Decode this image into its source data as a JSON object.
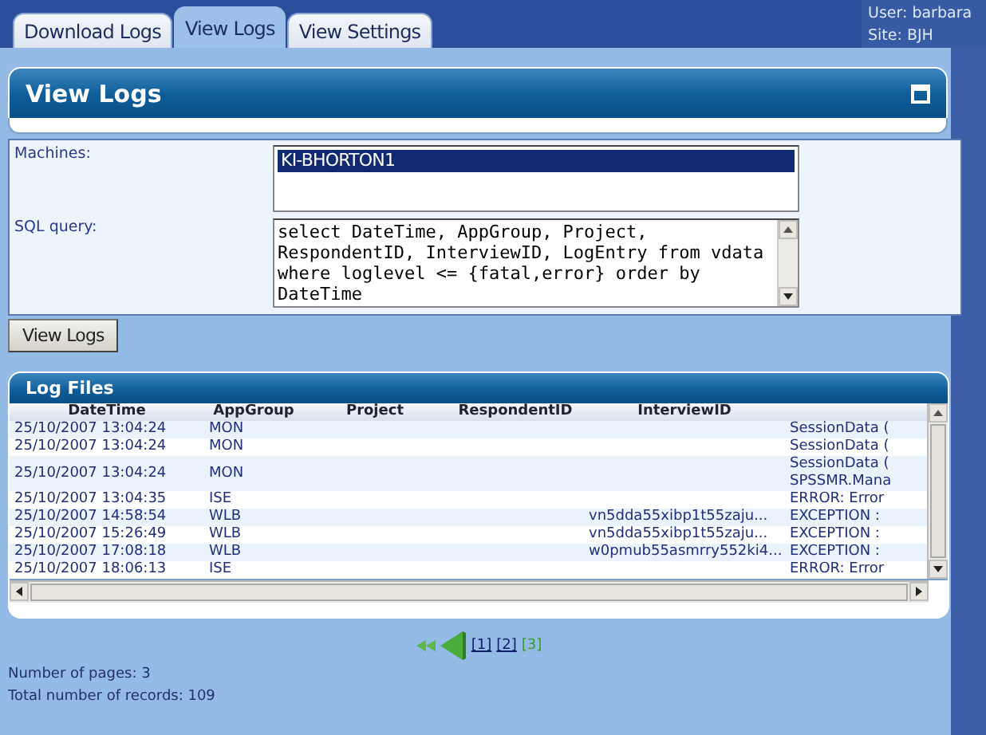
{
  "tabs": [
    {
      "label": "Download Logs",
      "selected": false
    },
    {
      "label": "View Logs",
      "selected": true
    },
    {
      "label": "View Settings",
      "selected": false
    }
  ],
  "user_info": [
    "User: barbara",
    "Site: BJH"
  ],
  "panel": {
    "title": "View Logs"
  },
  "form": {
    "machines_label": "Machines:",
    "machines": [
      {
        "name": "KI-BHORTON1",
        "selected": true
      }
    ],
    "sql_label": "SQL query:",
    "sql_query": "select DateTime, AppGroup, Project, RespondentID, InterviewID, LogEntry from vdata where loglevel <= {fatal,error} order by DateTime",
    "button": "View Logs"
  },
  "log_files": {
    "title": "Log Files",
    "columns": [
      "DateTime",
      "AppGroup",
      "Project",
      "RespondentID",
      "InterviewID",
      ""
    ],
    "rows": [
      [
        "25/10/2007 13:04:24",
        "MON",
        "",
        "",
        "",
        "SessionData ("
      ],
      [
        "25/10/2007 13:04:24",
        "MON",
        "",
        "",
        "",
        "SessionData ("
      ],
      [
        "25/10/2007 13:04:24",
        "MON",
        "",
        "",
        "",
        "SessionData (\nSPSSMR.Mana"
      ],
      [
        "25/10/2007 13:04:35",
        "ISE",
        "",
        "",
        "",
        "ERROR: Error"
      ],
      [
        "25/10/2007 14:58:54",
        "WLB",
        "",
        "",
        "vn5dda55xibp1t55zaju...",
        "EXCEPTION :"
      ],
      [
        "25/10/2007 15:26:49",
        "WLB",
        "",
        "",
        "vn5dda55xibp1t55zaju...",
        "EXCEPTION :"
      ],
      [
        "25/10/2007 17:08:18",
        "WLB",
        "",
        "",
        "w0pmub55asmrry552ki4...",
        "EXCEPTION :"
      ],
      [
        "25/10/2007 18:06:13",
        "ISE",
        "",
        "",
        "",
        "ERROR: Error"
      ]
    ]
  },
  "pager": {
    "pages": [
      {
        "label": "[1]",
        "selected": false
      },
      {
        "label": "[2]",
        "selected": false
      },
      {
        "label": "[3]",
        "selected": true
      }
    ]
  },
  "summary": [
    "Number of pages: 3",
    "Total number of records: 109"
  ]
}
